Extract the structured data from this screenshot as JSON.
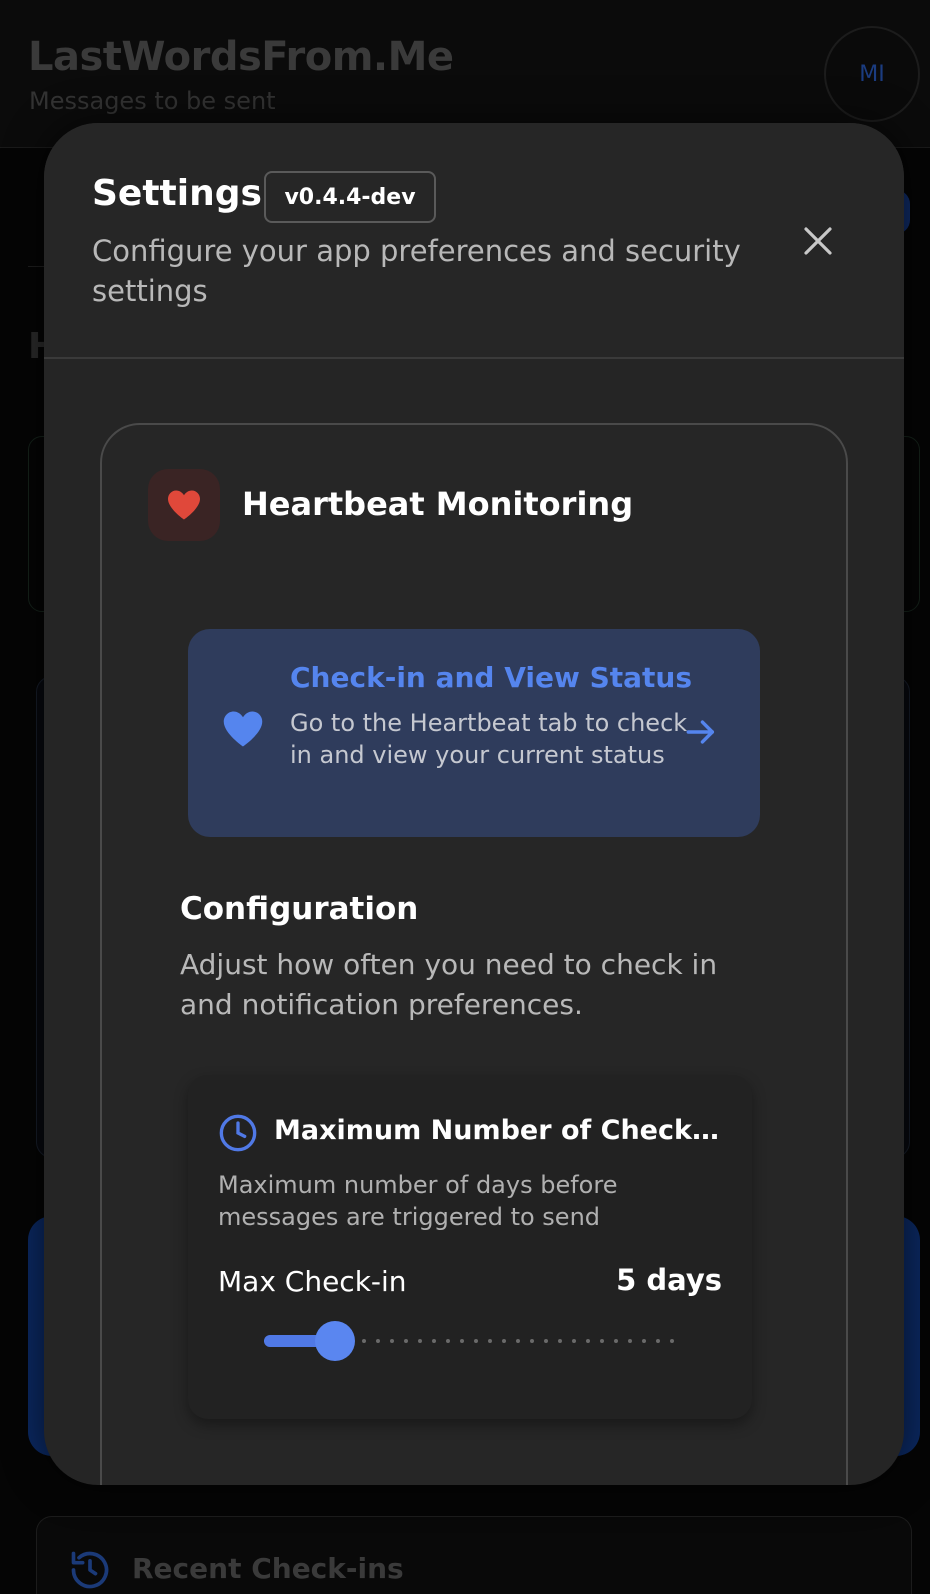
{
  "app": {
    "title": "LastWordsFrom.Me",
    "subtitle": "Messages to be sent",
    "avatar_initials": "MI",
    "background_heading_partial": "H",
    "recent_checkins_label": "Recent Check-ins"
  },
  "settings_modal": {
    "title": "Settings",
    "version": "v0.4.4-dev",
    "description": "Configure your app preferences and security settings",
    "close_icon": "close-icon"
  },
  "heartbeat": {
    "section_title": "Heartbeat Monitoring",
    "icon": "heart-icon",
    "icon_color": "#e0483a",
    "checkin_link": {
      "title": "Check-in and View Status",
      "text": "Go to the Heartbeat tab to check in and view your current status",
      "accent_color": "#5585ee"
    },
    "configuration": {
      "title": "Configuration",
      "description": "Adjust how often you need to check in and notification preferences."
    },
    "max_checkin": {
      "title": "Maximum Number of Check-in Days",
      "description": "Maximum number of days before messages are triggered to send",
      "label": "Max Check-in",
      "value_text": "5 days",
      "value": 5,
      "min": 1,
      "max": 30
    }
  },
  "colors": {
    "accent": "#5079e6",
    "modal_bg": "#252525",
    "page_bg": "#050505"
  }
}
